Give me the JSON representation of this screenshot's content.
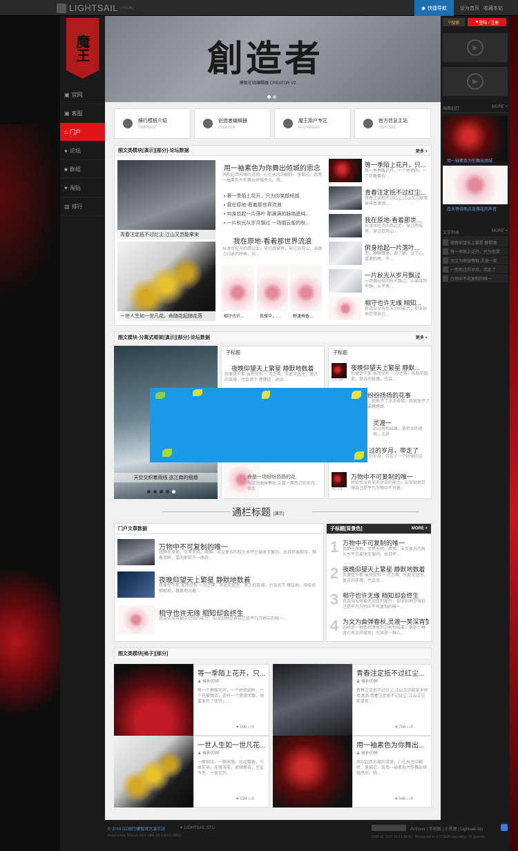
{
  "topbar": {
    "logo": "LIGHTSAIL",
    "logo_small": "VISUAL",
    "quicknav": "快捷导航",
    "links": [
      "设为首页",
      "收藏本站"
    ]
  },
  "brand": {
    "text": "魔王"
  },
  "nav": [
    "官网",
    "客服",
    "门户",
    "论坛",
    "群组",
    "淘贴",
    "排行"
  ],
  "hero": {
    "title": "創造者",
    "subtitle": "模板在线编辑器 CREATOR V2"
  },
  "right": {
    "search": "搜索",
    "login": "登陆 / 注册",
    "head1": "画面幻灯",
    "more": "MORE +",
    "cap1": "用一袖素色为你舞出倾城",
    "cap2": "白天等待雨点击落花的声音",
    "head2": "文字列表",
    "list": [
      "夜晚仰望天上繁星 静默地",
      "等一季陌上花开，只为你笑",
      "为文为曲弹春秋,灵渡一笑",
      "一剪雨过的岁月，带走了",
      "万物中不可复制的唯一"
    ]
  },
  "cards": [
    {
      "t": "横行模板介绍",
      "s": "TEMPLATE"
    },
    {
      "t": "创造者编辑器",
      "s": "CREATOR"
    },
    {
      "t": "魔王用户专区",
      "s": "EXCHANGES"
    },
    {
      "t": "官方信息主站",
      "s": "LIGHTSAIL"
    }
  ],
  "p1": {
    "title": "图文类模块[演示][部分]-论坛数据",
    "more": "更多 +",
    "img1": "青春注定抵不过红尘,江山又岂能拿来",
    "img2": "一世人生如一世凡花，命随花起随花落",
    "h1": "用一袖素色为你舞出倾城的思念",
    "s1": "风吹起西苏裙的涟漪，心在执念中翻转。落幕边，我用一抽素色为你舞出倾城思念。我...",
    "list": [
      "等一季陌上花开，只为你笑颜倾城",
      "我在原地-看着那世界流浪",
      "何身拾起一片落叶 那满满的脉络是纯...",
      "一片秋光从岁月飘过 一场烟云般的秋..."
    ],
    "h2": "我在原地-看着那世界流浪",
    "s2": "从漫水往河的西边走，穿过西城巷，穿过日月山，当踏上归途的时候，苏...",
    "thumbs": [
      "相守也许...",
      "我撑伞，...",
      "野渡梅香..."
    ],
    "r": [
      {
        "t": "等一季陌上花开，只...",
        "s": "等一季春暖花开，一个娇艳的，一个花瓣舞衣..."
      },
      {
        "t": "青春注定抵不过红尘...",
        "s": "青春注定抵不过红尘,江山又岂能拿来快意潇洒..."
      },
      {
        "t": "我在原地-看着那世...",
        "s": "从漫水往河的西边走，穿过西城巷，穿过日月山..."
      },
      {
        "t": "俯身拾起一片落叶...",
        "s": "而，静静飘落，谢了翻，湿了心。谁谢的雨，不..."
      },
      {
        "t": "一片秋光从岁月飘过",
        "s": "一场烟云般的秋光飘过，从某绿到平静，从平等..."
      },
      {
        "t": "相守也许无缘 相知...",
        "s": "我自知没有惊天动的能力，却深刻地觉得自己..."
      }
    ]
  },
  "p2": {
    "title": "图文模块-分离式框架[演示][部分]-论坛数据",
    "more": "更多 +",
    "sub": "子标题",
    "cap": "天空交织着雨线 这江南的细烟",
    "l": [
      {
        "t": "夜晚仰望天上繁星 静默地数着",
        "s": "我便是午那 虽然仅有 一河之隔，天庭花园里，复古的玫瑰，也会洒下 缠缠绕，纳烧..."
      },
      {
        "t": "命是一场纷纷扬扬的花",
        "s": "为文为曲弹春秋,灵渡一舞而过的岁月，带走"
      }
    ],
    "r": [
      {
        "t": "夜晚仰望天上繁星 静默...",
        "s": "我便是午那 虽然仅有 一河之隔，天庭花园里，复古的玫瑰，也会...",
        "d": "01-06"
      },
      {
        "t": "纷纷扬扬的花事",
        "s": "，就免不了凉凉柔情；我就免不了要缠缠绵"
      },
      {
        "t": "灵渡一",
        "s": "的过程和结果，更有余的搓烦，尤其"
      },
      {
        "t": "过的岁月，带走了",
        "s": "的岁月，带走了一个时候的这"
      },
      {
        "t": "万物中不可复制的唯一",
        "s": "我知我没有被天动日的能力，却深刻地觉得自己是平凡万物中不可复...",
        "d": "02-01"
      }
    ]
  },
  "sec": {
    "title": "通栏标题",
    "tag": "[演示]"
  },
  "p3": {
    "title": "门户文章数据",
    "items": [
      {
        "t": "万物中不可复制的唯一",
        "s": "我静在原地，坐等天明。烯烯。末及复苏的枝头水平已被收至窗间，尚且怀揣期待，静着双眸，望向那前方一路奔..."
      },
      {
        "t": "夜晚仰望天上繁星 静默地数着",
        "s": "我便是午那 虽然仅有 一河之隔，天庭花园里，复古的玫瑰，也会流下 缠绕地，烧烧地 朝朝地，暮暮地沿着..."
      },
      {
        "t": "相守也许无缘 相知却会终生",
        "s": "我自知没有被天动日的能力，却深刻地觉得自己是平凡万物中的唯一..."
      }
    ]
  },
  "p4": {
    "title": "子标题[背景色]",
    "more": "MORE +",
    "items": [
      {
        "n": "1",
        "t": "万物中不可复制的唯一",
        "s": "我静在原地，坐等天明。烯烯。末及复苏的枝头水平已被收至窗间，尚且怀..."
      },
      {
        "n": "2",
        "t": "夜晚仰望天上繁星 静默地数着",
        "s": "我便是午那 虽然仅有 一河之隔，天庭花园里，复古的玫瑰，也会流..."
      },
      {
        "n": "3",
        "t": "相守也许无缘 相知却会终生",
        "s": "我自知没有被天动日的能力，却深刻地觉得自己是平凡万物中不可复制的唯一..."
      },
      {
        "n": "4",
        "t": "为文为曲弹春秋,灵渡一笑深宵梦",
        "s": "内啥是一种惨然凄怆的过程和结果，更是一种游刃有余的搓烦；尤其是一种心..."
      }
    ]
  },
  "p5": {
    "title": "图文类模块[格子][部分]",
    "items": [
      {
        "t": "等一季陌上花开，只...",
        "a": "候补的神",
        "s": "等一个春暖花开，一个娇艳欲醉，一个花瓣舞衣，还有一个遗遗而飘，快要渐尽了忧伤；...",
        "c": "596",
        "r": "0"
      },
      {
        "t": "青春注定抵不过红尘...",
        "a": "候补的神",
        "s": "青春注定抵不过红尘,江山又岂能拿来快意潇洒 青春注定抵不过红尘,江山又岂能拿来...",
        "c": "756",
        "r": "0"
      },
      {
        "t": "一世人生如一世凡花...",
        "a": "候补的神",
        "s": "一瞬观花，一瞬闻落。花绽飘香，引君前来。花落凋零，君随春去。至此今生，一夜花开...",
        "c": "539",
        "r": "0"
      },
      {
        "t": "用一袖素色为你舞出...",
        "a": "候补的神",
        "s": "风吹起西苏裙的涟漪，心在执念中翻转。落幕边，我用一袖素色为你舞出倾城思念。隔...",
        "c": "946",
        "r": "0"
      }
    ]
  },
  "footer": {
    "c1": "© 2016 DZ现行模板官方演示站",
    "c2": "LIGHTSAIL STU",
    "c3": "Powered by Discuz! X3.2 GBK X3.3 R20170801",
    "links": "Archiver | 手机版 | 小黑屋 | Lightsail.Stu",
    "time": "GMT+8, 2017-11-14 08:30 , Processed in 0.073035 second(s), 16 queries ."
  }
}
